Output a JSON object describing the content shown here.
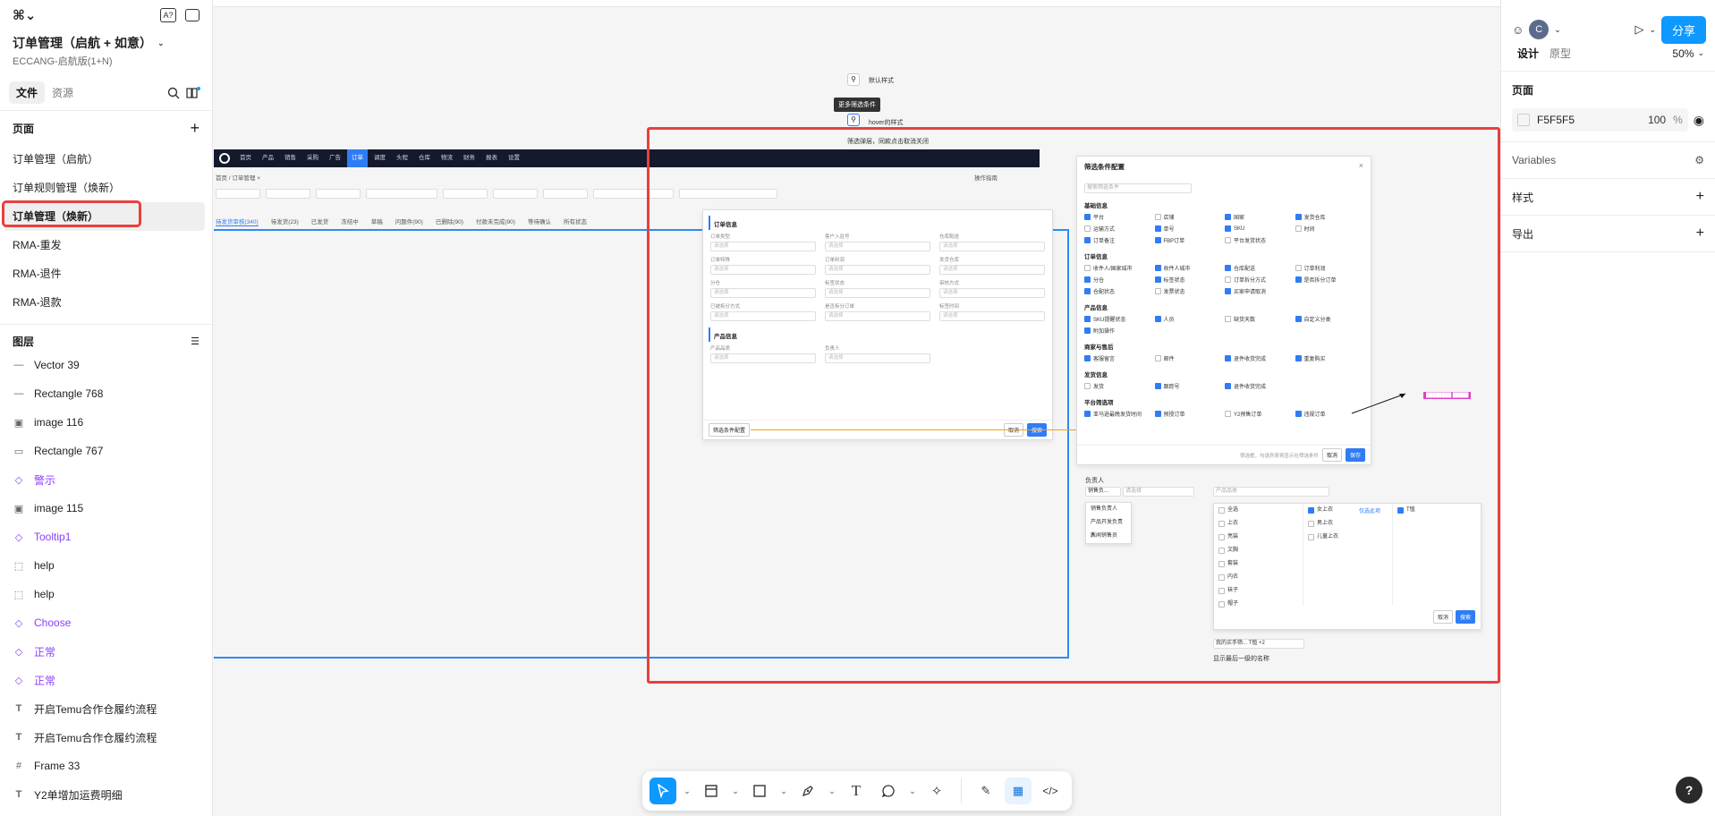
{
  "header": {
    "file_title": "订单管理（启航 + 如意）",
    "file_subtitle": "ECCANG-启航版(1+N)"
  },
  "left_tabs": {
    "file": "文件",
    "assets": "资源"
  },
  "pages": {
    "title": "页面",
    "items": [
      "订单管理（启航）",
      "订单规则管理（焕新）",
      "订单管理（焕新）",
      "RMA-重发",
      "RMA-退件",
      "RMA-退款"
    ]
  },
  "layers": {
    "title": "图层",
    "items": [
      {
        "name": "Vector 39",
        "icon": "vector-icon",
        "glyph": "—"
      },
      {
        "name": "Rectangle 768",
        "icon": "line-icon",
        "glyph": "—"
      },
      {
        "name": "image 116",
        "icon": "image-icon",
        "glyph": "▣"
      },
      {
        "name": "Rectangle 767",
        "icon": "rectangle-icon",
        "glyph": "▭"
      },
      {
        "name": "警示",
        "icon": "component-icon",
        "glyph": "◇"
      },
      {
        "name": "image 115",
        "icon": "image-icon",
        "glyph": "▣"
      },
      {
        "name": "Tooltip1",
        "icon": "component-icon",
        "glyph": "◇"
      },
      {
        "name": "help",
        "icon": "frame-dashed-icon",
        "glyph": "⬚"
      },
      {
        "name": "help",
        "icon": "frame-dashed-icon",
        "glyph": "⬚"
      },
      {
        "name": "Choose",
        "icon": "component-icon",
        "glyph": "◇"
      },
      {
        "name": "正常",
        "icon": "component-icon",
        "glyph": "◇"
      },
      {
        "name": "正常",
        "icon": "component-icon",
        "glyph": "◇"
      },
      {
        "name": "开启Temu合作仓履约流程",
        "icon": "text-icon",
        "glyph": "T"
      },
      {
        "name": "开启Temu合作仓履约流程",
        "icon": "text-icon",
        "glyph": "T"
      },
      {
        "name": "Frame 33",
        "icon": "frame-icon",
        "glyph": "#"
      },
      {
        "name": "Y2单增加运费明细",
        "icon": "text-icon",
        "glyph": "T"
      }
    ]
  },
  "right": {
    "avatar_initial": "C",
    "share_label": "分享",
    "tab_design": "设计",
    "tab_prototype": "原型",
    "zoom": "50%",
    "page_section": "页面",
    "fill_hex": "F5F5F5",
    "fill_opacity": "100",
    "fill_unit": "%",
    "variables": "Variables",
    "styles": "样式",
    "export": "导出",
    "help": "?"
  },
  "canvas": {
    "label_default": "默认样式",
    "label_hover": "hover的样式",
    "tooltip_more": "更多筛选条件",
    "note_top": "筛选弹层，同款点击取消关闭",
    "nav_items": [
      "首页",
      "产品",
      "销售",
      "采购",
      "广告",
      "订单",
      "调度",
      "头程",
      "仓库",
      "物流",
      "财务",
      "报表",
      "设置"
    ],
    "nav_active": "订单",
    "breadcrumb": "首页 / 订单管理 ×",
    "action_link": "操作指南",
    "status_tabs": [
      "待发货审核(340)",
      "待发货(23)",
      "已发货",
      "冻结中",
      "草稿",
      "问题件(90)",
      "已删除(90)",
      "付款未完成(90)",
      "等待确认",
      "所有状态"
    ],
    "panel_title": "订单信息",
    "panel_fields": [
      "订单类型",
      "客户入驻号",
      "仓库配送",
      "订单特殊",
      "订单利润",
      "发货仓库",
      "分仓",
      "标签状态",
      "审核方式",
      "已被拆分方式",
      "是否拆分订单",
      "标签时间"
    ],
    "panel_sec2": "产品信息",
    "panel_sec2_fields": [
      "产品品类",
      "负责人"
    ],
    "panel_foot_left": "筛选条件配置",
    "panel_cancel": "取消",
    "panel_search": "搜索",
    "placeholder": "请选择",
    "config_title": "筛选条件配置",
    "config_search": "搜索筛选条件",
    "config_groups": [
      {
        "title": "基础信息",
        "items": [
          "平台",
          "店铺",
          "国家",
          "发货仓库",
          "运输方式",
          "单号",
          "SKU",
          "时间",
          "订单备注",
          "FBP订单",
          "平台发货状态"
        ]
      },
      {
        "title": "订单信息",
        "items": [
          "收件人/国家城市",
          "收件人城市",
          "仓库配送",
          "订单利润",
          "分仓",
          "标签状态",
          "订单拆分方式",
          "是否拆分订单",
          "仓配状态",
          "发票状态",
          "买家申请取消"
        ]
      },
      {
        "title": "产品信息",
        "items": [
          "SKU提醒状态",
          "人员",
          "缺货天数",
          "自定义分类",
          "附加操作"
        ]
      },
      {
        "title": "商家与售后",
        "items": [
          "客服留言",
          "邮件",
          "退件收货完成",
          "重复购买"
        ]
      },
      {
        "title": "发货信息",
        "items": [
          "发货",
          "跟踪号",
          "退件收货完成"
        ]
      },
      {
        "title": "平台筛选项",
        "items": [
          "亚马逊最晚发货时间",
          "预授订单",
          "Y2预售订单",
          "违规订单"
        ]
      }
    ],
    "config_foot_note": "筛选框，勾选列表将显示在筛选条件",
    "config_cancel": "取消",
    "config_save": "保存",
    "owner_label": "负责人",
    "owner_select": "销售负...",
    "owner_menu": [
      "销售负责人",
      "产品开发负责人",
      "新闻销售员"
    ],
    "category_placeholder": "产品品类",
    "cascade_col1": [
      "全选",
      "上衣",
      "亮装",
      "文胸",
      "套装",
      "内衣",
      "袜子",
      "帽子"
    ],
    "cascade_col2": [
      "女上衣",
      "男上衣",
      "儿童上衣"
    ],
    "cascade_col3": [
      "T恤"
    ],
    "cascade_link": "仅选此项",
    "cascade_cancel": "取消",
    "cascade_ok": "搜索",
    "multi_select": "我的买手筛...  T恤  +2",
    "multi_hint": "显示最后一级的名称",
    "pink_tag": "████████ █████"
  },
  "toolbar": {
    "move": "move-tool",
    "frame": "frame-tool",
    "shape": "shape-tool",
    "pen": "pen-tool",
    "text": "T",
    "comment": "comment-tool",
    "actions": "actions-tool",
    "draw": "draw-mode",
    "design": "design-mode",
    "dev": "dev-mode"
  },
  "colors": {
    "accent": "#0d99ff",
    "highlight_red": "#e8403f",
    "frame_blue": "#2a8cf2",
    "canvas_bg": "#f5f5f5"
  }
}
